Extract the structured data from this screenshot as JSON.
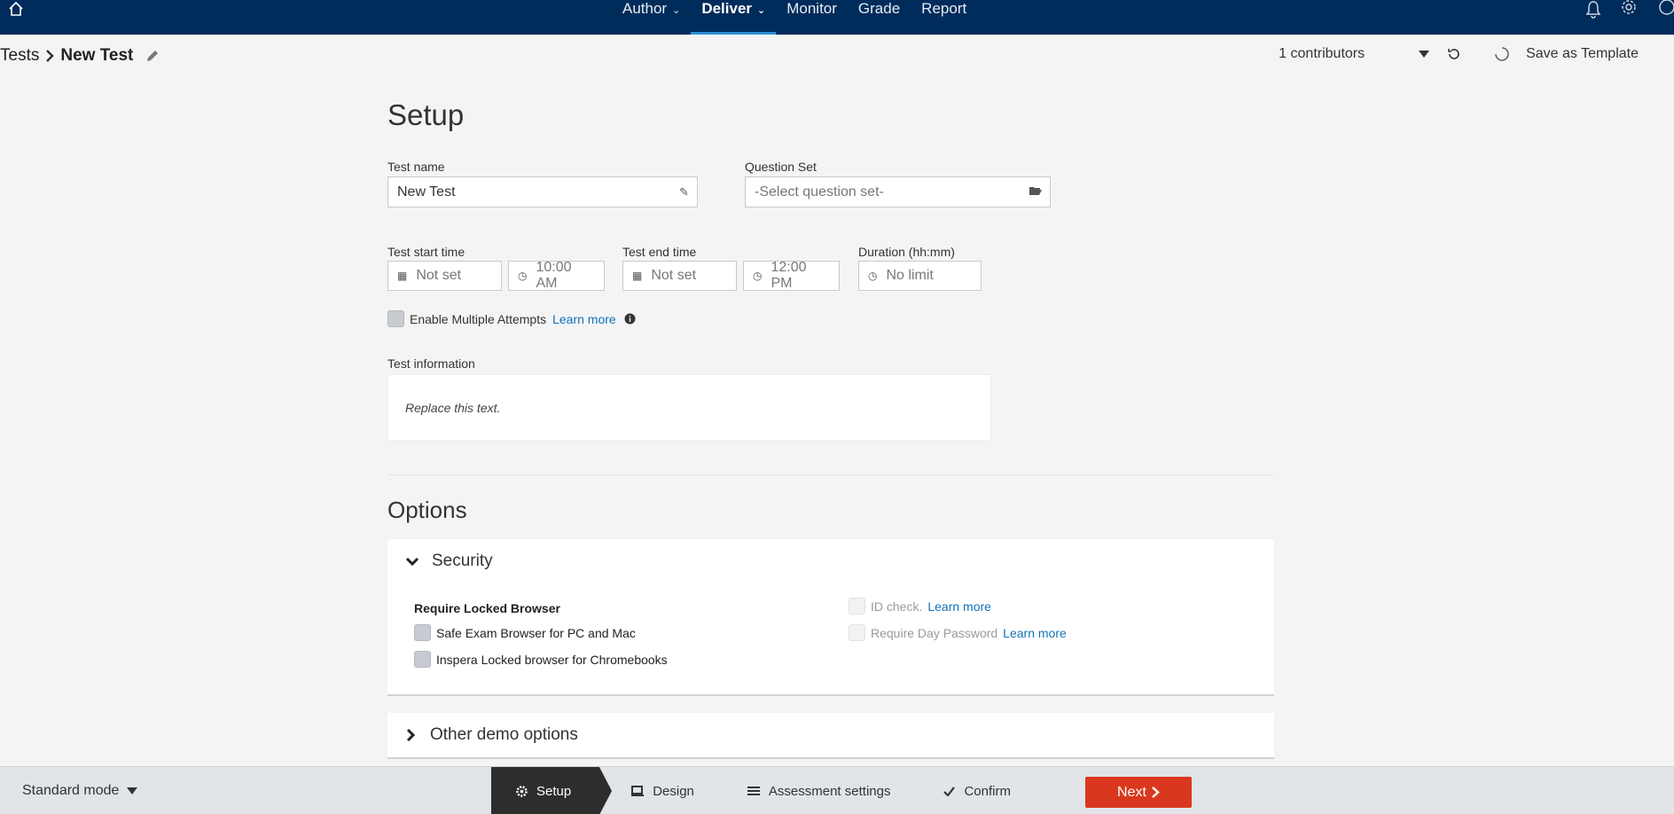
{
  "nav": {
    "items": [
      {
        "label": "Author",
        "has_menu": true
      },
      {
        "label": "Deliver",
        "has_menu": true,
        "active": true
      },
      {
        "label": "Monitor"
      },
      {
        "label": "Grade"
      },
      {
        "label": "Report"
      }
    ],
    "right_icons": [
      "bell-icon",
      "gear-icon",
      "help-icon"
    ]
  },
  "breadcrumb": {
    "parent": "Tests",
    "current": "New Test"
  },
  "toolbar": {
    "contributors": "1 contributors",
    "save_template": "Save as Template"
  },
  "setup": {
    "title": "Setup",
    "test_name": {
      "label": "Test name",
      "value": "New Test"
    },
    "question_set": {
      "label": "Question Set",
      "placeholder": "-Select question set-"
    },
    "start": {
      "label": "Test start time",
      "date": "Not set",
      "time": "10:00 AM"
    },
    "end": {
      "label": "Test end time",
      "date": "Not set",
      "time": "12:00 PM"
    },
    "duration": {
      "label": "Duration (hh:mm)",
      "value": "No limit"
    },
    "multiple_attempts": {
      "label": "Enable Multiple Attempts",
      "learn_more": "Learn more"
    },
    "info": {
      "label": "Test information",
      "text": "Replace this text."
    }
  },
  "options": {
    "title": "Options",
    "security": {
      "title": "Security",
      "locked_browser_heading": "Require Locked Browser",
      "seb": "Safe Exam Browser for PC and Mac",
      "inspera": "Inspera Locked browser for Chromebooks",
      "id_check": "ID check.",
      "id_learn": "Learn more",
      "day_password": "Require Day Password",
      "day_learn": "Learn more"
    },
    "other": {
      "title": "Other demo options"
    }
  },
  "bottom": {
    "mode": "Standard mode",
    "steps": [
      {
        "label": "Setup",
        "active": true
      },
      {
        "label": "Design"
      },
      {
        "label": "Assessment settings"
      },
      {
        "label": "Confirm"
      }
    ],
    "next": "Next"
  },
  "colors": {
    "nav_bg": "#002c5b",
    "accent": "#2f8fd5",
    "next_button": "#d9381e",
    "link": "#1372b8"
  }
}
